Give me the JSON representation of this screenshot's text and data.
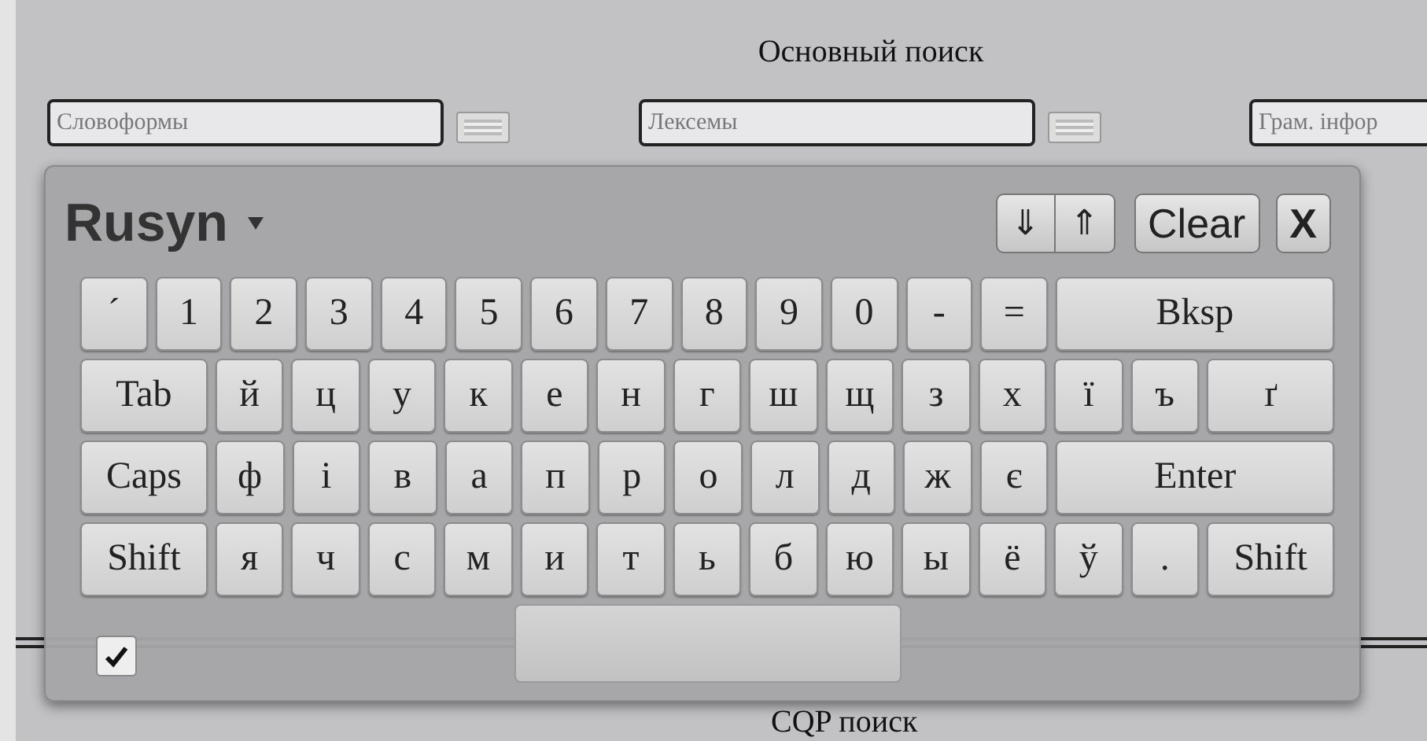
{
  "heading": "Основный поиск",
  "fields": [
    {
      "placeholder": "Словоформы",
      "keyboard_button": true
    },
    {
      "placeholder": "Лексемы",
      "keyboard_button": true
    },
    {
      "placeholder": "Грам. інфор",
      "keyboard_button": false
    }
  ],
  "keyboard": {
    "layout": "Rusyn",
    "arrows": [
      "⇓",
      "⇑"
    ],
    "clear": "Clear",
    "close": "X",
    "rows": [
      {
        "keys": [
          {
            "label": "´",
            "kind": "char"
          },
          {
            "label": "1",
            "kind": "char"
          },
          {
            "label": "2",
            "kind": "char"
          },
          {
            "label": "3",
            "kind": "char"
          },
          {
            "label": "4",
            "kind": "char"
          },
          {
            "label": "5",
            "kind": "char"
          },
          {
            "label": "6",
            "kind": "char"
          },
          {
            "label": "7",
            "kind": "char"
          },
          {
            "label": "8",
            "kind": "char"
          },
          {
            "label": "9",
            "kind": "char"
          },
          {
            "label": "0",
            "kind": "char"
          },
          {
            "label": "-",
            "kind": "char"
          },
          {
            "label": "=",
            "kind": "char"
          },
          {
            "label": "Bksp",
            "kind": "backspace"
          }
        ]
      },
      {
        "keys": [
          {
            "label": "Tab",
            "kind": "tab"
          },
          {
            "label": "й",
            "kind": "char"
          },
          {
            "label": "ц",
            "kind": "char"
          },
          {
            "label": "у",
            "kind": "char"
          },
          {
            "label": "к",
            "kind": "char"
          },
          {
            "label": "е",
            "kind": "char"
          },
          {
            "label": "н",
            "kind": "char"
          },
          {
            "label": "г",
            "kind": "char"
          },
          {
            "label": "ш",
            "kind": "char"
          },
          {
            "label": "щ",
            "kind": "char"
          },
          {
            "label": "з",
            "kind": "char"
          },
          {
            "label": "х",
            "kind": "char"
          },
          {
            "label": "ї",
            "kind": "char"
          },
          {
            "label": "ъ",
            "kind": "char"
          },
          {
            "label": "ґ",
            "kind": "tab"
          }
        ]
      },
      {
        "keys": [
          {
            "label": "Caps",
            "kind": "tab"
          },
          {
            "label": "ф",
            "kind": "char"
          },
          {
            "label": "і",
            "kind": "char"
          },
          {
            "label": "в",
            "kind": "char"
          },
          {
            "label": "а",
            "kind": "char"
          },
          {
            "label": "п",
            "kind": "char"
          },
          {
            "label": "р",
            "kind": "char"
          },
          {
            "label": "о",
            "kind": "char"
          },
          {
            "label": "л",
            "kind": "char"
          },
          {
            "label": "д",
            "kind": "char"
          },
          {
            "label": "ж",
            "kind": "char"
          },
          {
            "label": "є",
            "kind": "char"
          },
          {
            "label": "Enter",
            "kind": "enter"
          }
        ]
      },
      {
        "keys": [
          {
            "label": "Shift",
            "kind": "tab"
          },
          {
            "label": "я",
            "kind": "char"
          },
          {
            "label": "ч",
            "kind": "char"
          },
          {
            "label": "с",
            "kind": "char"
          },
          {
            "label": "м",
            "kind": "char"
          },
          {
            "label": "и",
            "kind": "char"
          },
          {
            "label": "т",
            "kind": "char"
          },
          {
            "label": "ь",
            "kind": "char"
          },
          {
            "label": "б",
            "kind": "char"
          },
          {
            "label": "ю",
            "kind": "char"
          },
          {
            "label": "ы",
            "kind": "char"
          },
          {
            "label": "ё",
            "kind": "char"
          },
          {
            "label": "ў",
            "kind": "char"
          },
          {
            "label": ".",
            "kind": "char"
          },
          {
            "label": "Shift",
            "kind": "tab"
          }
        ]
      }
    ],
    "checkbox": {
      "checked": true
    }
  },
  "footer": "CQP поиск"
}
